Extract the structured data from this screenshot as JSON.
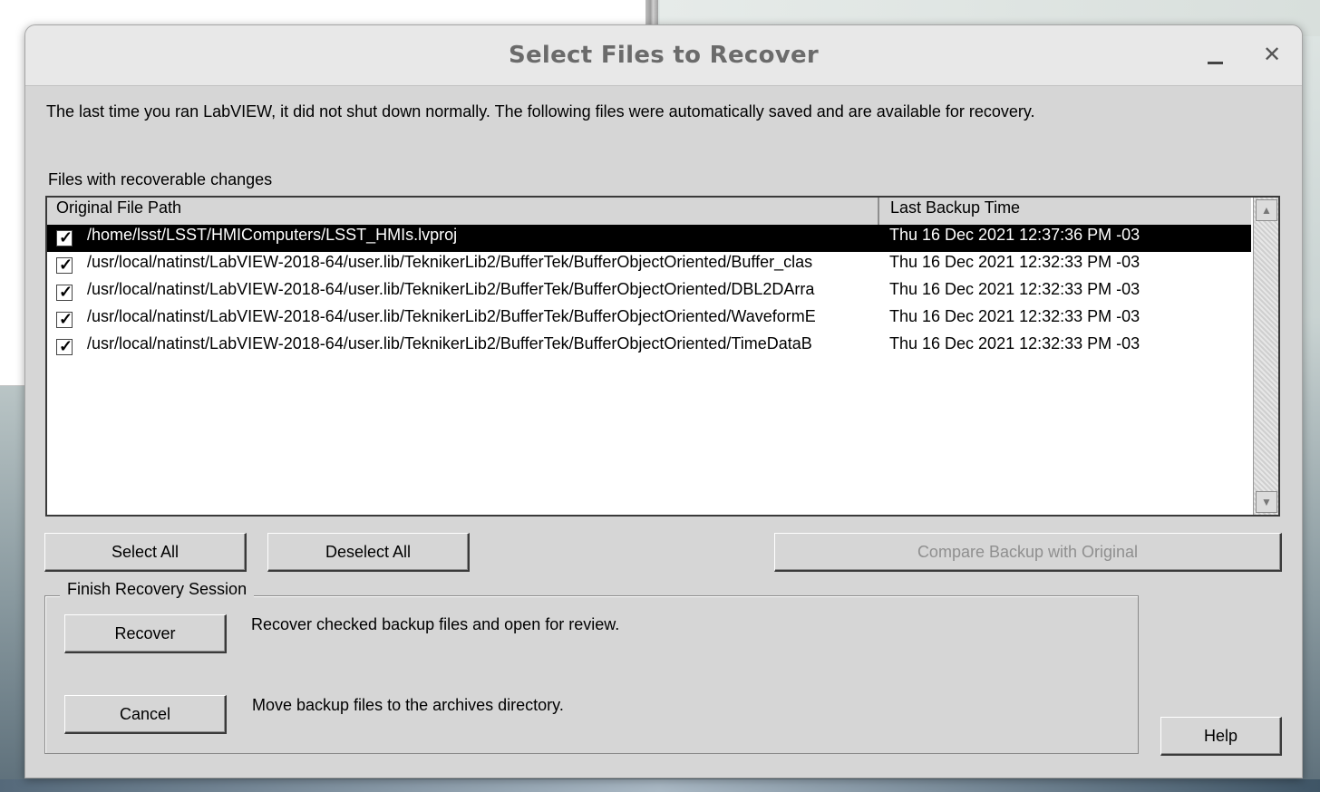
{
  "dialog": {
    "title": "Select Files to Recover",
    "minimize_label": "_",
    "close_label": "✕",
    "intro": "The last time you ran LabVIEW, it did not shut down normally. The following files were automatically saved and are available for recovery.",
    "files_label": "Files with recoverable changes"
  },
  "table": {
    "columns": [
      "Original File Path",
      "Last Backup Time"
    ],
    "rows": [
      {
        "checked": true,
        "selected": true,
        "path": "/home/lsst/LSST/HMIComputers/LSST_HMIs.lvproj",
        "time": "Thu 16 Dec 2021 12:37:36 PM -03"
      },
      {
        "checked": true,
        "selected": false,
        "path": "/usr/local/natinst/LabVIEW-2018-64/user.lib/TeknikerLib2/BufferTek/BufferObjectOriented/Buffer_clas",
        "time": "Thu 16 Dec 2021 12:32:33 PM -03"
      },
      {
        "checked": true,
        "selected": false,
        "path": "/usr/local/natinst/LabVIEW-2018-64/user.lib/TeknikerLib2/BufferTek/BufferObjectOriented/DBL2DArra",
        "time": "Thu 16 Dec 2021 12:32:33 PM -03"
      },
      {
        "checked": true,
        "selected": false,
        "path": "/usr/local/natinst/LabVIEW-2018-64/user.lib/TeknikerLib2/BufferTek/BufferObjectOriented/WaveformE",
        "time": "Thu 16 Dec 2021 12:32:33 PM -03"
      },
      {
        "checked": true,
        "selected": false,
        "path": "/usr/local/natinst/LabVIEW-2018-64/user.lib/TeknikerLib2/BufferTek/BufferObjectOriented/TimeDataB",
        "time": "Thu 16 Dec 2021 12:32:33 PM -03"
      }
    ],
    "check_glyph": "✓",
    "scroll_up_glyph": "▲",
    "scroll_down_glyph": "▼"
  },
  "buttons": {
    "select_all": "Select All",
    "deselect_all": "Deselect All",
    "compare": "Compare Backup with Original",
    "recover": "Recover",
    "cancel": "Cancel",
    "help": "Help"
  },
  "finish_group": {
    "legend": "Finish Recovery Session",
    "recover_desc": "Recover checked backup files and open for review.",
    "cancel_desc": "Move backup files to the archives directory."
  },
  "colors": {
    "dialog_bg": "#d6d6d6",
    "selected_row_bg": "#000000",
    "disabled_text": "#8f8f8f"
  }
}
